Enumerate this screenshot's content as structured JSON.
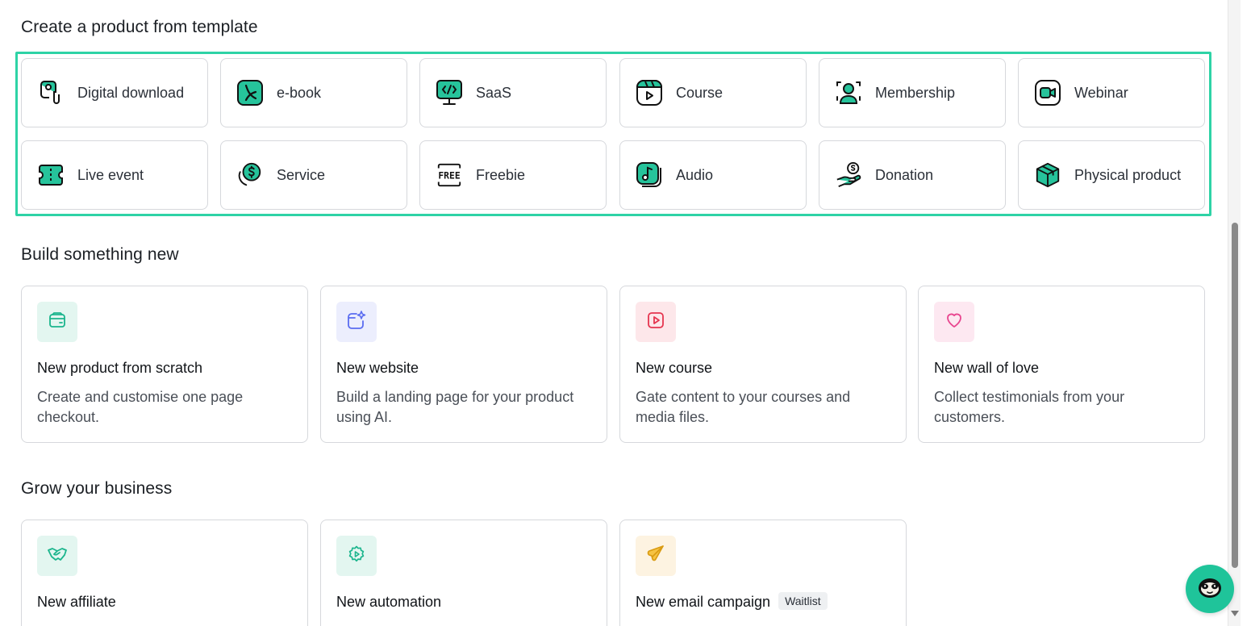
{
  "sections": {
    "templates_title": "Create a product from template",
    "build_title": "Build something new",
    "grow_title": "Grow your business"
  },
  "templates": [
    {
      "label": "Digital download",
      "icon": "digital-download-icon"
    },
    {
      "label": "e-book",
      "icon": "pdf-icon"
    },
    {
      "label": "SaaS",
      "icon": "code-monitor-icon"
    },
    {
      "label": "Course",
      "icon": "course-play-icon"
    },
    {
      "label": "Membership",
      "icon": "membership-user-icon"
    },
    {
      "label": "Webinar",
      "icon": "webinar-camera-icon"
    },
    {
      "label": "Live event",
      "icon": "ticket-icon"
    },
    {
      "label": "Service",
      "icon": "dollar-coin-icon"
    },
    {
      "label": "Freebie",
      "icon": "free-tag-icon"
    },
    {
      "label": "Audio",
      "icon": "music-note-icon"
    },
    {
      "label": "Donation",
      "icon": "donation-hand-icon"
    },
    {
      "label": "Physical product",
      "icon": "box-icon"
    }
  ],
  "build": [
    {
      "title": "New product from scratch",
      "desc": "Create and customise one page checkout.",
      "icon": "package-icon",
      "tile_color": "#e3f6f0"
    },
    {
      "title": "New website",
      "desc": "Build a landing page for your product using AI.",
      "icon": "ai-sparkle-icon",
      "tile_color": "#eceefd"
    },
    {
      "title": "New course",
      "desc": "Gate content to your courses and media files.",
      "icon": "video-play-icon",
      "tile_color": "#fde7ea"
    },
    {
      "title": "New wall of love",
      "desc": "Collect testimonials from your customers.",
      "icon": "heart-icon",
      "tile_color": "#fde8f1"
    }
  ],
  "grow": [
    {
      "title": "New affiliate",
      "icon": "handshake-icon",
      "tile_color": "#e3f6f0"
    },
    {
      "title": "New automation",
      "icon": "automation-gear-icon",
      "tile_color": "#e3f6f0"
    },
    {
      "title": "New email campaign",
      "badge": "Waitlist",
      "icon": "paper-plane-icon",
      "tile_color": "#fdf3e1"
    }
  ],
  "colors": {
    "accent": "#1fc49a",
    "highlight_border": "#2ed3a6"
  },
  "chat": {
    "icon": "chat-mascot-icon"
  }
}
